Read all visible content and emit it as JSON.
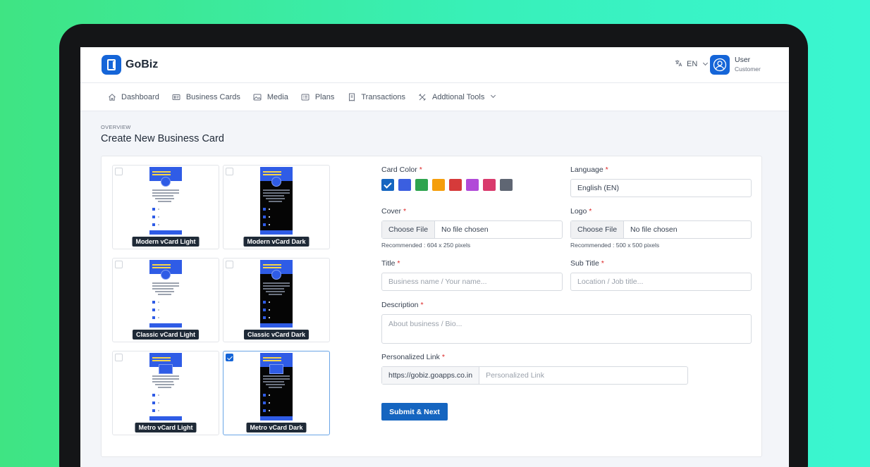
{
  "brand": {
    "name": "GoBiz"
  },
  "header": {
    "language_code": "EN",
    "user_name": "User",
    "user_role": "Customer"
  },
  "nav": [
    {
      "label": "Dashboard",
      "icon": "home-icon"
    },
    {
      "label": "Business Cards",
      "icon": "id-card-icon"
    },
    {
      "label": "Media",
      "icon": "image-icon"
    },
    {
      "label": "Plans",
      "icon": "list-icon"
    },
    {
      "label": "Transactions",
      "icon": "receipt-icon"
    },
    {
      "label": "Addtional Tools",
      "icon": "tools-icon"
    }
  ],
  "page": {
    "overline": "OVERVIEW",
    "title": "Create New Business Card"
  },
  "templates": [
    {
      "label": "Modern vCard Light",
      "theme": "light",
      "style": "modern",
      "selected": false
    },
    {
      "label": "Modern vCard Dark",
      "theme": "dark",
      "style": "modern",
      "selected": false
    },
    {
      "label": "Classic vCard Light",
      "theme": "light",
      "style": "classic",
      "selected": false
    },
    {
      "label": "Classic vCard Dark",
      "theme": "dark",
      "style": "classic",
      "selected": false
    },
    {
      "label": "Metro vCard Light",
      "theme": "light",
      "style": "metro",
      "selected": false
    },
    {
      "label": "Metro vCard Dark",
      "theme": "dark",
      "style": "metro",
      "selected": true
    }
  ],
  "form": {
    "card_color_label": "Card Color",
    "card_colors": [
      {
        "name": "blue-dark",
        "hex": "#1565c0",
        "selected": true
      },
      {
        "name": "blue",
        "hex": "#3b5fe0",
        "selected": false
      },
      {
        "name": "green",
        "hex": "#2ea44f",
        "selected": false
      },
      {
        "name": "yellow",
        "hex": "#f59e0b",
        "selected": false
      },
      {
        "name": "red",
        "hex": "#d63a3a",
        "selected": false
      },
      {
        "name": "purple",
        "hex": "#b14ad8",
        "selected": false
      },
      {
        "name": "pink",
        "hex": "#d93a6c",
        "selected": false
      },
      {
        "name": "gray",
        "hex": "#5f6673",
        "selected": false
      }
    ],
    "language_label": "Language",
    "language_value": "English (EN)",
    "cover_label": "Cover",
    "cover_button": "Choose File",
    "cover_status": "No file chosen",
    "cover_hint": "Recommended : 604 x 250 pixels",
    "logo_label": "Logo",
    "logo_button": "Choose File",
    "logo_status": "No file chosen",
    "logo_hint": "Recommended : 500 x 500 pixels",
    "title_label": "Title",
    "title_placeholder": "Business name / Your name...",
    "subtitle_label": "Sub Title",
    "subtitle_placeholder": "Location / Job title...",
    "description_label": "Description",
    "description_placeholder": "About business / Bio...",
    "link_label": "Personalized Link",
    "link_prefix": "https://gobiz.goapps.co.in",
    "link_placeholder": "Personalized Link",
    "submit_label": "Submit & Next",
    "required_mark": "*"
  }
}
